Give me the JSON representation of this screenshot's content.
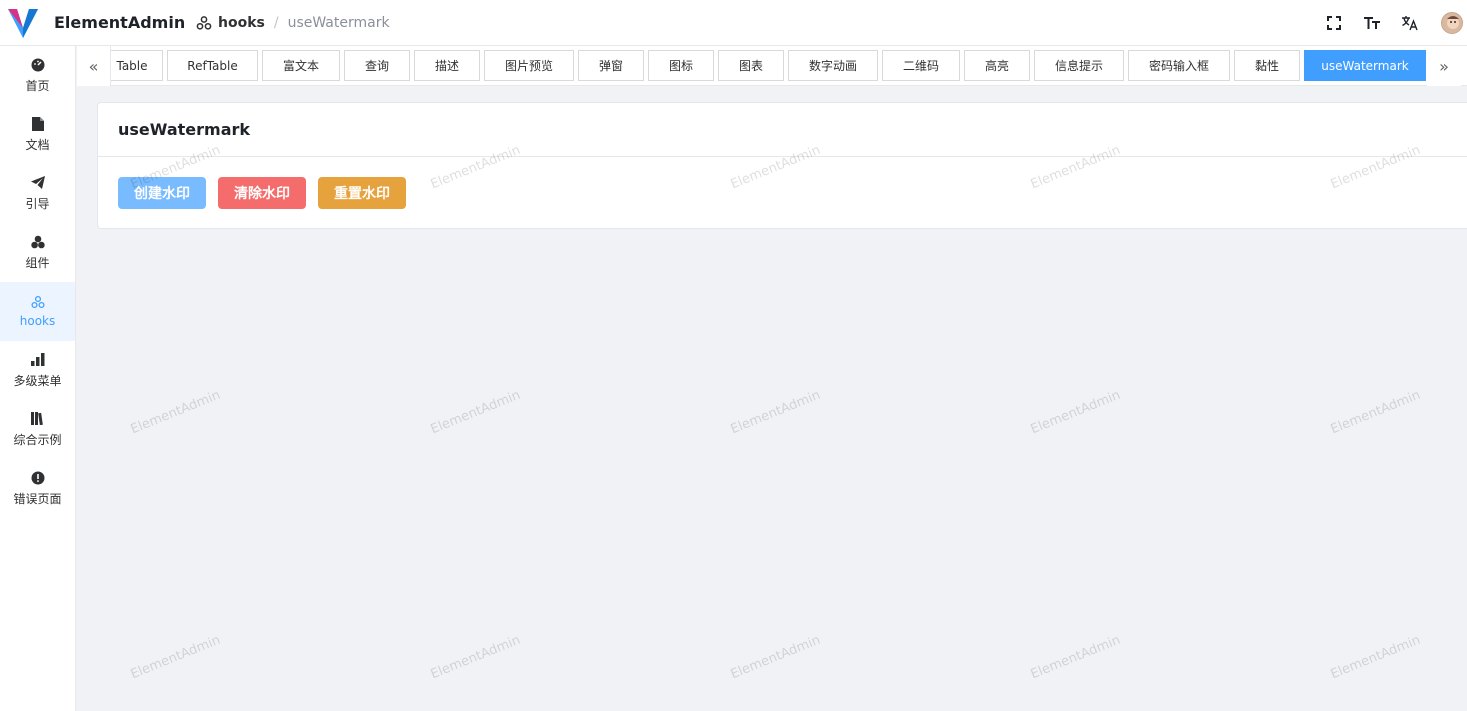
{
  "app": {
    "title": "ElementAdmin"
  },
  "breadcrumb": {
    "parent": "hooks",
    "separator": "/",
    "current": "useWatermark"
  },
  "header_tools": [
    {
      "name": "fullscreen-icon"
    },
    {
      "name": "font-size-icon"
    },
    {
      "name": "translate-icon"
    },
    {
      "name": "avatar"
    }
  ],
  "sidebar": {
    "items": [
      {
        "label": "首页",
        "icon": "dashboard-icon"
      },
      {
        "label": "文档",
        "icon": "document-icon"
      },
      {
        "label": "引导",
        "icon": "paper-plane-icon"
      },
      {
        "label": "组件",
        "icon": "components-icon"
      },
      {
        "label": "hooks",
        "icon": "hooks-icon",
        "active": true
      },
      {
        "label": "多级菜单",
        "icon": "bar-chart-icon"
      },
      {
        "label": "综合示例",
        "icon": "books-icon"
      },
      {
        "label": "错误页面",
        "icon": "error-icon"
      }
    ]
  },
  "tags": {
    "items": [
      {
        "label": "Table"
      },
      {
        "label": "RefTable"
      },
      {
        "label": "富文本"
      },
      {
        "label": "查询"
      },
      {
        "label": "描述"
      },
      {
        "label": "图片预览"
      },
      {
        "label": "弹窗"
      },
      {
        "label": "图标"
      },
      {
        "label": "图表"
      },
      {
        "label": "数字动画"
      },
      {
        "label": "二维码"
      },
      {
        "label": "高亮"
      },
      {
        "label": "信息提示"
      },
      {
        "label": "密码输入框"
      },
      {
        "label": "黏性"
      },
      {
        "label": "useWatermark",
        "active": true
      }
    ],
    "left_arrow": "«",
    "right_arrow": "»"
  },
  "card": {
    "title": "useWatermark",
    "buttons": [
      {
        "label": "创建水印",
        "type": "primary"
      },
      {
        "label": "清除水印",
        "type": "danger"
      },
      {
        "label": "重置水印",
        "type": "warning"
      }
    ]
  },
  "watermark": {
    "text": "ElementAdmin"
  },
  "colors": {
    "primary": "#409eff",
    "danger": "#f56c6c",
    "warning": "#e6a23c",
    "background": "#f0f2f5"
  }
}
